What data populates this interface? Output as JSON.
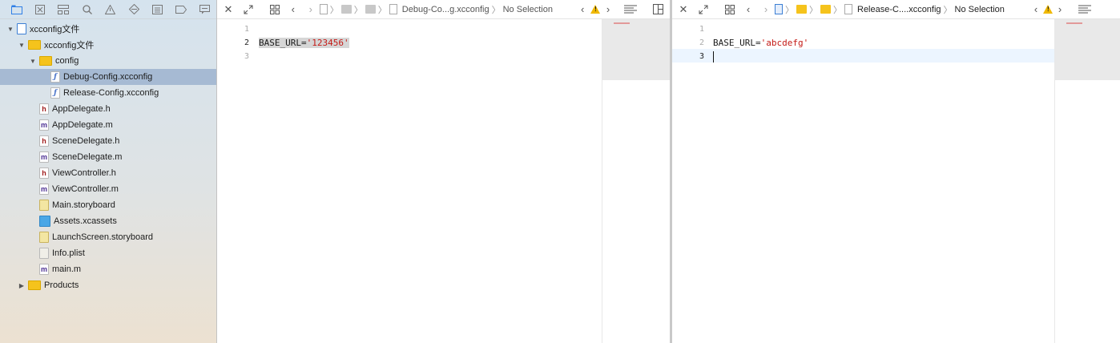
{
  "navigator": {
    "toolbar_icons": [
      "folder-icon",
      "warning-x-icon",
      "hierarchy-icon",
      "search-icon",
      "issue-warning-icon",
      "test-diamond-icon",
      "list-icon",
      "tag-icon",
      "comment-icon"
    ],
    "items": [
      {
        "label": "xcconfig文件",
        "kind": "project",
        "depth": 0,
        "disclosure": "open",
        "selected": false
      },
      {
        "label": "xcconfig文件",
        "kind": "folder",
        "depth": 1,
        "disclosure": "open",
        "selected": false
      },
      {
        "label": "config",
        "kind": "folder",
        "depth": 2,
        "disclosure": "open",
        "selected": false
      },
      {
        "label": "Debug-Config.xcconfig",
        "kind": "xcconfig",
        "depth": 3,
        "disclosure": "",
        "selected": true
      },
      {
        "label": "Release-Config.xcconfig",
        "kind": "xcconfig",
        "depth": 3,
        "disclosure": "",
        "selected": false
      },
      {
        "label": "AppDelegate.h",
        "kind": "h",
        "depth": 2,
        "disclosure": "",
        "selected": false
      },
      {
        "label": "AppDelegate.m",
        "kind": "m",
        "depth": 2,
        "disclosure": "",
        "selected": false
      },
      {
        "label": "SceneDelegate.h",
        "kind": "h",
        "depth": 2,
        "disclosure": "",
        "selected": false
      },
      {
        "label": "SceneDelegate.m",
        "kind": "m",
        "depth": 2,
        "disclosure": "",
        "selected": false
      },
      {
        "label": "ViewController.h",
        "kind": "h",
        "depth": 2,
        "disclosure": "",
        "selected": false
      },
      {
        "label": "ViewController.m",
        "kind": "m",
        "depth": 2,
        "disclosure": "",
        "selected": false
      },
      {
        "label": "Main.storyboard",
        "kind": "storyboard",
        "depth": 2,
        "disclosure": "",
        "selected": false
      },
      {
        "label": "Assets.xcassets",
        "kind": "assets",
        "depth": 2,
        "disclosure": "",
        "selected": false
      },
      {
        "label": "LaunchScreen.storyboard",
        "kind": "storyboard",
        "depth": 2,
        "disclosure": "",
        "selected": false
      },
      {
        "label": "Info.plist",
        "kind": "plist",
        "depth": 2,
        "disclosure": "",
        "selected": false
      },
      {
        "label": "main.m",
        "kind": "m",
        "depth": 2,
        "disclosure": "",
        "selected": false
      },
      {
        "label": "Products",
        "kind": "folder",
        "depth": 1,
        "disclosure": "closed",
        "selected": false
      }
    ]
  },
  "left_editor": {
    "breadcrumb_file": "Debug-Co...g.xcconfig",
    "breadcrumb_selection": "No Selection",
    "line_numbers": [
      "1",
      "2",
      "3"
    ],
    "current_line": "2",
    "code": {
      "key": "BASE_URL=",
      "value": "'123456'"
    }
  },
  "right_editor": {
    "breadcrumb_file": "Release-C....xcconfig",
    "breadcrumb_selection": "No Selection",
    "line_numbers": [
      "1",
      "2",
      "3"
    ],
    "current_line": "3",
    "code": {
      "key": "BASE_URL=",
      "value": "'abcdefg'"
    }
  },
  "colors": {
    "selection": "#a6bad3",
    "string": "#c41a16",
    "current_line_bg": "#ecf5ff"
  }
}
